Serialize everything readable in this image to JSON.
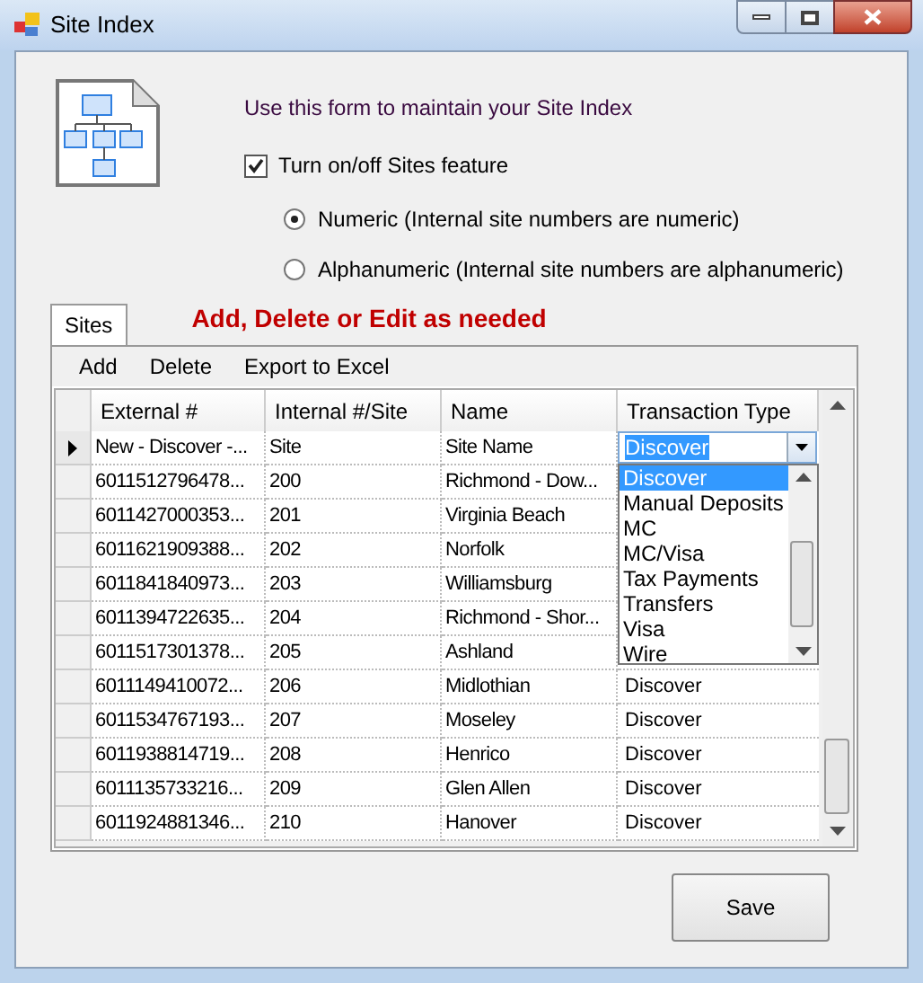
{
  "window": {
    "title": "Site Index"
  },
  "intro": "Use this form to maintain your Site Index",
  "feature_toggle": {
    "label": "Turn on/off Sites feature",
    "checked": true
  },
  "numbering": [
    {
      "label": "Numeric (Internal site numbers are numeric)",
      "selected": true
    },
    {
      "label": "Alphanumeric (Internal site numbers are alphanumeric)",
      "selected": false
    }
  ],
  "tabs": [
    {
      "label": "Sites",
      "selected": true
    }
  ],
  "heading": "Add, Delete or Edit as needed",
  "toolbar": [
    "Add",
    "Delete",
    "Export to Excel"
  ],
  "table": {
    "columns": [
      "External #",
      "Internal #/Site",
      "Name",
      "Transaction Type"
    ],
    "rows": [
      {
        "external": "New - Discover -...",
        "internal": "Site",
        "name": "Site Name",
        "current": true
      },
      {
        "external": "6011512796478...",
        "internal": "200",
        "name": "Richmond - Dow...",
        "current": false
      },
      {
        "external": "6011427000353...",
        "internal": "201",
        "name": "Virginia Beach",
        "current": false
      },
      {
        "external": "6011621909388...",
        "internal": "202",
        "name": "Norfolk",
        "current": false
      },
      {
        "external": "6011841840973...",
        "internal": "203",
        "name": "Williamsburg",
        "current": false
      },
      {
        "external": "6011394722635...",
        "internal": "204",
        "name": "Richmond - Shor...",
        "current": false
      },
      {
        "external": "6011517301378...",
        "internal": "205",
        "name": "Ashland",
        "current": false
      },
      {
        "external": "6011149410072...",
        "internal": "206",
        "name": "Midlothian",
        "transaction_type": "Discover",
        "current": false
      },
      {
        "external": "6011534767193...",
        "internal": "207",
        "name": "Moseley",
        "transaction_type": "Discover",
        "current": false
      },
      {
        "external": "6011938814719...",
        "internal": "208",
        "name": "Henrico",
        "transaction_type": "Discover",
        "current": false
      },
      {
        "external": "6011135733216...",
        "internal": "209",
        "name": "Glen Allen",
        "transaction_type": "Discover",
        "current": false
      },
      {
        "external": "6011924881346...",
        "internal": "210",
        "name": "Hanover",
        "transaction_type": "Discover",
        "current": false
      }
    ]
  },
  "dropdown": {
    "value": "Discover",
    "items": [
      {
        "label": "Discover",
        "selected": true
      },
      {
        "label": "Manual Deposits",
        "selected": false
      },
      {
        "label": "MC",
        "selected": false
      },
      {
        "label": "MC/Visa",
        "selected": false
      },
      {
        "label": "Tax Payments",
        "selected": false
      },
      {
        "label": "Transfers",
        "selected": false
      },
      {
        "label": "Visa",
        "selected": false
      },
      {
        "label": "Wire",
        "selected": false
      }
    ]
  },
  "buttons": [
    "Save"
  ]
}
